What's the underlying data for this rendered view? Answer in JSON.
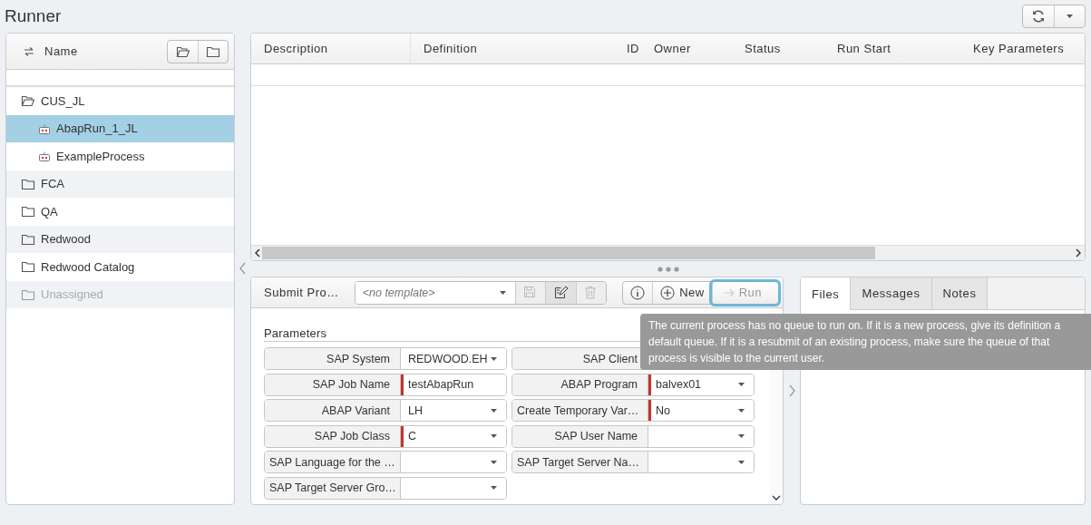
{
  "window": {
    "title": "Runner"
  },
  "tree_panel": {
    "column": "Name"
  },
  "tree": [
    {
      "label": "CUS_JL",
      "kind": "folder",
      "expanded": true,
      "disabled": false,
      "selected": false,
      "children": [
        {
          "label": "AbapRun_1_JL",
          "kind": "process",
          "disabled": false,
          "selected": true
        },
        {
          "label": "ExampleProcess",
          "kind": "process",
          "disabled": false,
          "selected": false
        }
      ]
    },
    {
      "label": "FCA",
      "kind": "folder",
      "expanded": false,
      "disabled": false,
      "selected": false
    },
    {
      "label": "QA",
      "kind": "folder",
      "expanded": false,
      "disabled": false,
      "selected": false
    },
    {
      "label": "Redwood",
      "kind": "folder",
      "expanded": false,
      "disabled": false,
      "selected": false
    },
    {
      "label": "Redwood Catalog",
      "kind": "folder",
      "expanded": false,
      "disabled": false,
      "selected": false
    },
    {
      "label": "Unassigned",
      "kind": "folder",
      "expanded": false,
      "disabled": true,
      "selected": false
    }
  ],
  "table": {
    "columns": [
      "Description",
      "Definition",
      "ID",
      "Owner",
      "Status",
      "Run Start",
      "Key Parameters"
    ]
  },
  "submit": {
    "title": "Submit Pro…",
    "template": {
      "placeholder": "<no template>"
    },
    "template_actions": [
      {
        "kind": "save",
        "disabled": true
      },
      {
        "kind": "edit",
        "disabled": false
      },
      {
        "kind": "delete",
        "disabled": true
      }
    ],
    "actions": [
      {
        "kind": "info",
        "disabled": false,
        "focused": false
      },
      {
        "kind": "new",
        "label": "New",
        "disabled": false,
        "focused": false
      },
      {
        "kind": "run",
        "label": "Run",
        "disabled": true,
        "focused": true
      }
    ],
    "section": "Parameters",
    "fields": [
      {
        "label": "SAP System",
        "value": "REDWOOD.EH",
        "kind": "dropdown",
        "required": false
      },
      {
        "label": "SAP Client"
      },
      {
        "label": "SAP Job Name",
        "value": "testAbapRun",
        "kind": "text",
        "required": true
      },
      {
        "label": "ABAP Program",
        "value": "balvex01",
        "kind": "dropdown",
        "required": true
      },
      {
        "label": "ABAP Variant",
        "value": "LH",
        "kind": "dropdown",
        "required": false
      },
      {
        "label": "Create Temporary Var…",
        "value": "No",
        "kind": "dropdown",
        "required": true
      },
      {
        "label": "SAP Job Class",
        "value": "C",
        "kind": "dropdown",
        "required": true
      },
      {
        "label": "SAP User Name",
        "kind": "dropdown",
        "required": false
      },
      {
        "label": "SAP Language for the …",
        "kind": "dropdown",
        "required": false
      },
      {
        "label": "SAP Target Server Na…",
        "kind": "dropdown",
        "required": false
      },
      {
        "label": "SAP Target Server Gro…",
        "kind": "dropdown",
        "required": false
      }
    ]
  },
  "detail_tabs": [
    {
      "label": "Files",
      "selected": true
    },
    {
      "label": "Messages",
      "selected": false
    },
    {
      "label": "Notes",
      "selected": false
    }
  ],
  "tooltip": {
    "text": "The current process has no queue to run on. If it is a new process, give its definition a default queue. If it is a resubmit of an existing process, make sure the queue of that process is visible to the current user."
  }
}
